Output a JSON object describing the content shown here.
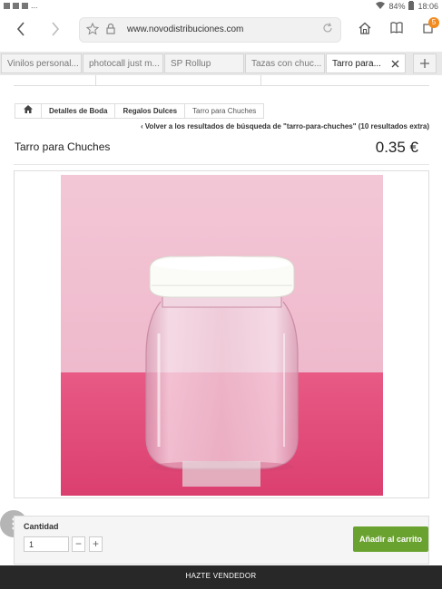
{
  "status_bar": {
    "notification_ellipsis": "...",
    "battery": "84%",
    "time": "18:06"
  },
  "browser": {
    "url": "www.novodistribuciones.com",
    "tab_count_badge": "5",
    "tabs": [
      {
        "label": "Vinilos personal..."
      },
      {
        "label": "photocall just m..."
      },
      {
        "label": "SP Rollup"
      },
      {
        "label": "Tazas con chuc..."
      },
      {
        "label": "Tarro para..."
      }
    ],
    "icons": {
      "back": "chevron-left-icon",
      "forward": "chevron-right-icon",
      "favorite": "star-icon",
      "secure": "lock-icon",
      "reload": "reload-icon",
      "home": "home-icon",
      "bookmarks": "book-icon",
      "tabs": "tab-manager-icon"
    }
  },
  "breadcrumb": {
    "items": [
      {
        "label": "Detalles de Boda"
      },
      {
        "label": "Regalos Dulces"
      },
      {
        "label": "Tarro para Chuches"
      }
    ]
  },
  "back_link": "Volver a los resultados de búsqueda de \"tarro-para-chuches\" (10 resultados extra)",
  "product": {
    "title": "Tarro para Chuches",
    "price": "0.35 €"
  },
  "cart": {
    "quantity_label": "Cantidad",
    "quantity_value": "1",
    "minus": "−",
    "plus": "+",
    "add_button": "Añadir al carrito"
  },
  "footer": {
    "label": "HAZTE VENDEDOR"
  },
  "colors": {
    "accent_green": "#6aa230",
    "photo_background": "#f0c2d2",
    "photo_floor": "#e4557f",
    "badge_orange": "#f28a1e"
  }
}
